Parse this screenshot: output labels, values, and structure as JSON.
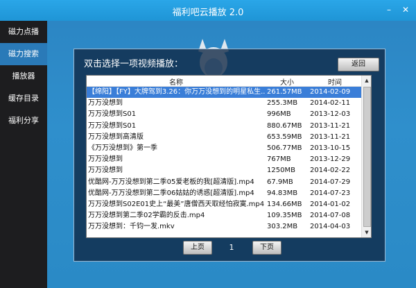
{
  "app": {
    "title": "福利吧云播放 2.0"
  },
  "window": {
    "minimize": "–",
    "close": "✕"
  },
  "sidebar": {
    "items": [
      {
        "label": "磁力点播",
        "active": false
      },
      {
        "label": "磁力搜索",
        "active": true
      },
      {
        "label": "播放器",
        "active": false
      },
      {
        "label": "缓存目录",
        "active": false
      },
      {
        "label": "福利分享",
        "active": false
      }
    ]
  },
  "panel": {
    "prompt": "双击选择一项视频播放：",
    "back_label": "返回",
    "columns": {
      "name": "名称",
      "size": "大小",
      "date": "时间"
    },
    "rows": [
      {
        "name": "【绵阳】【FY】大牌驾到3.26：你万万没想到的明星私生...",
        "size": "261.57MB",
        "date": "2014-02-09",
        "selected": true
      },
      {
        "name": "万万没想到",
        "size": "255.3MB",
        "date": "2014-02-11"
      },
      {
        "name": "万万没想到S01",
        "size": "996MB",
        "date": "2013-12-03"
      },
      {
        "name": "万万没想到S01",
        "size": "880.67MB",
        "date": "2013-11-21"
      },
      {
        "name": "万万没想到高清版",
        "size": "653.59MB",
        "date": "2013-11-21"
      },
      {
        "name": "《万万没想到》第一季",
        "size": "506.77MB",
        "date": "2013-10-15"
      },
      {
        "name": "万万没想到",
        "size": "767MB",
        "date": "2013-12-29"
      },
      {
        "name": "万万没想到",
        "size": "1250MB",
        "date": "2014-02-22"
      },
      {
        "name": "优酷网-万万没想到第二季05爱老板的我[超清版].mp4",
        "size": "67.9MB",
        "date": "2014-07-29"
      },
      {
        "name": "优酷网-万万没想到第二季06姑姑的诱惑[超清版].mp4",
        "size": "94.83MB",
        "date": "2014-07-23"
      },
      {
        "name": "万万没想到S02E01史上“最美”唐僧西天取经怕寂寞.mp4",
        "size": "134.66MB",
        "date": "2014-01-02"
      },
      {
        "name": "万万没想到第二季02学霸的反击.mp4",
        "size": "109.35MB",
        "date": "2014-07-08"
      },
      {
        "name": "万万没想到：千钧一发.mkv",
        "size": "303.2MB",
        "date": "2014-04-03"
      }
    ],
    "prev_label": "上页",
    "next_label": "下页",
    "page": "1"
  }
}
